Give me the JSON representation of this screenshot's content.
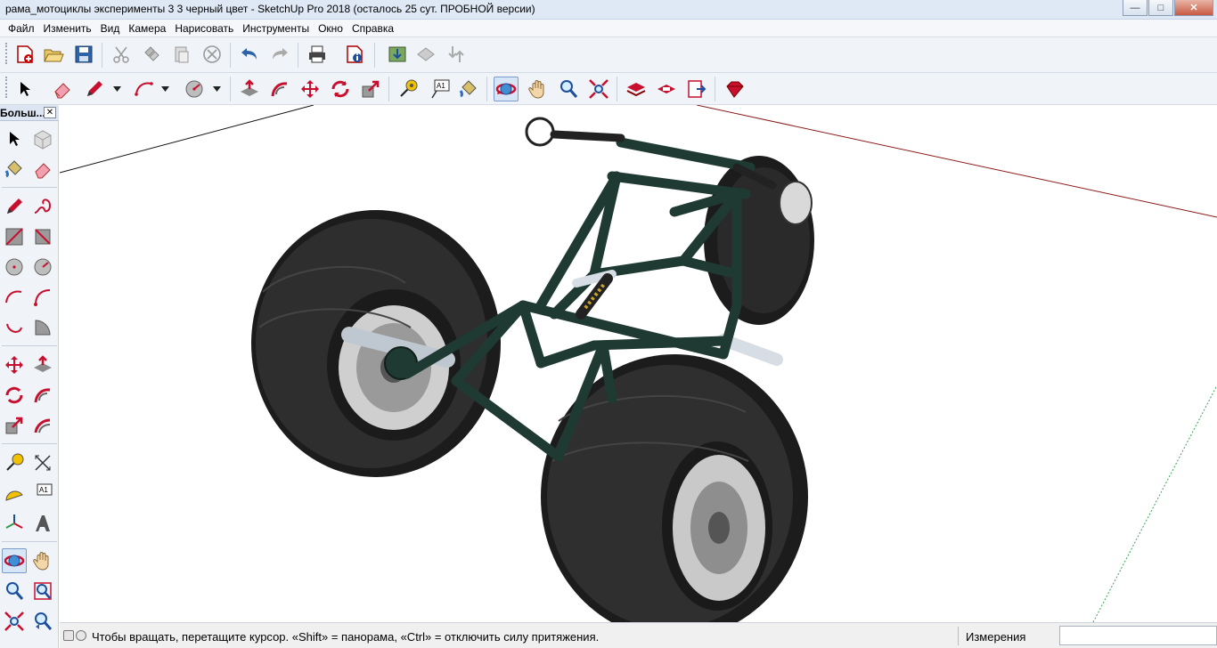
{
  "window": {
    "title": "рама_мотоциклы эксперименты 3 3  черный цвет - SketchUp Pro 2018 (осталось 25 сут. ПРОБНОЙ версии)",
    "minimize": "—",
    "maximize": "□",
    "close": "✕"
  },
  "menu": {
    "items": [
      {
        "label": "Файл"
      },
      {
        "label": "Изменить"
      },
      {
        "label": "Вид"
      },
      {
        "label": "Камера"
      },
      {
        "label": "Нарисовать"
      },
      {
        "label": "Инструменты"
      },
      {
        "label": "Окно"
      },
      {
        "label": "Справка"
      }
    ]
  },
  "toolbar_standard": {
    "tools": [
      "new-file-icon",
      "open-folder-icon",
      "save-icon",
      "cut-icon",
      "copy-icon",
      "paste-icon",
      "erase-icon",
      "undo-icon",
      "redo-icon",
      "print-icon",
      "model-info-icon",
      "warehouse-icon",
      "share-model-icon",
      "extension-icon"
    ]
  },
  "toolbar_main": {
    "tools": [
      "select-icon",
      "eraser-icon",
      "pencil-icon",
      "arc-icon",
      "circle-icon",
      "push-pull-icon",
      "follow-me-icon",
      "move-icon",
      "rotate-icon",
      "scale-icon",
      "tape-measure-icon",
      "text-icon",
      "paint-bucket-icon",
      "orbit-icon",
      "pan-icon",
      "zoom-icon",
      "zoom-extents-icon",
      "warehouse-get-icon",
      "extension-warehouse-icon",
      "send-to-layout-icon",
      "ruby-icon"
    ],
    "active": "orbit-icon"
  },
  "left_panel": {
    "title": "Больш...",
    "close": "✕",
    "active": "orbit-icon"
  },
  "status": {
    "hint": "Чтобы вращать, перетащите курсор. «Shift» = панорама, «Ctrl» = отключить силу притяжения.",
    "measure_label": "Измерения",
    "measure_value": ""
  },
  "colors": {
    "frame": "#1f3a32",
    "tire": "#2b2b2b",
    "axis_red": "#8b1a1a",
    "axis_green": "#3ea35a",
    "selection": "#d7e6f7"
  }
}
